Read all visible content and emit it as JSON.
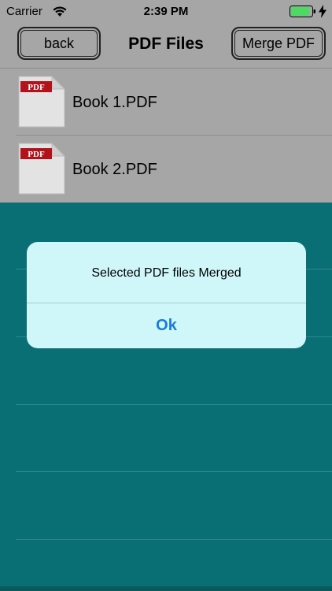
{
  "status_bar": {
    "carrier": "Carrier",
    "time": "2:39 PM",
    "battery_level": 0.9,
    "battery_color": "#4cd964"
  },
  "nav": {
    "back_label": "back",
    "title": "PDF Files",
    "merge_label": "Merge PDF"
  },
  "files": [
    {
      "name": "Book 1.PDF",
      "icon": "pdf-file-icon",
      "icon_badge": "PDF"
    },
    {
      "name": "Book 2.PDF",
      "icon": "pdf-file-icon",
      "icon_badge": "PDF"
    }
  ],
  "alert": {
    "message": "Selected PDF files Merged",
    "ok_label": "Ok"
  },
  "colors": {
    "header_gray": "#a6a6a6",
    "teal_background": "#0a6f74",
    "alert_background": "#cff7f9",
    "alert_button_blue": "#1a7ae0",
    "pdf_badge_red": "#b3121a"
  }
}
